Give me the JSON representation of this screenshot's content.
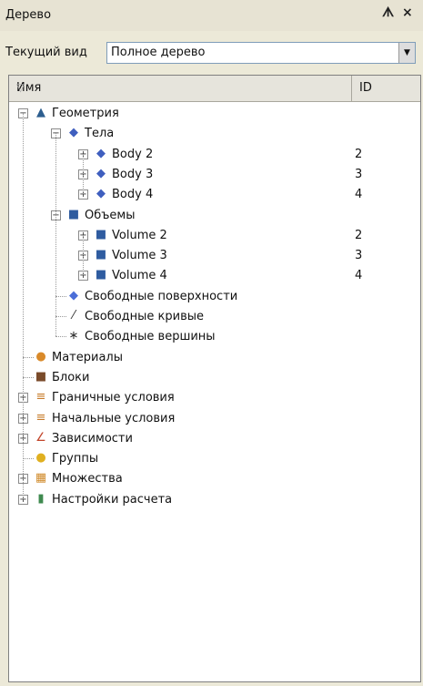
{
  "window": {
    "title": "Дерево",
    "pin_glyph": "ᗑ",
    "close_glyph": "×"
  },
  "view": {
    "label": "Текущий вид",
    "selected": "Полное дерево"
  },
  "columns": {
    "name": "Имя",
    "id": "ID"
  },
  "tree": [
    {
      "label": "Геометрия",
      "id": "",
      "level": 0,
      "icon": "geometry-icon",
      "glyph": "▲",
      "color": "#2d5e8f",
      "expander": "⊟"
    },
    {
      "label": "Тела",
      "id": "",
      "level": 1,
      "icon": "bodies-icon",
      "glyph": "◆",
      "color": "#3f5fbf",
      "expander": "⊟"
    },
    {
      "label": "Body 2",
      "id": "2",
      "level": 2,
      "icon": "body-icon",
      "glyph": "◆",
      "color": "#3f5fbf",
      "expander": "⊞"
    },
    {
      "label": "Body 3",
      "id": "3",
      "level": 2,
      "icon": "body-icon",
      "glyph": "◆",
      "color": "#3f5fbf",
      "expander": "⊞"
    },
    {
      "label": "Body 4",
      "id": "4",
      "level": 2,
      "icon": "body-icon",
      "glyph": "◆",
      "color": "#3f5fbf",
      "expander": "⊞"
    },
    {
      "label": "Объемы",
      "id": "",
      "level": 1,
      "icon": "volumes-icon",
      "glyph": "■",
      "color": "#2f5ca0",
      "expander": "⊟"
    },
    {
      "label": "Volume 2",
      "id": "2",
      "level": 2,
      "icon": "volume-icon",
      "glyph": "■",
      "color": "#2f5ca0",
      "expander": "⊞"
    },
    {
      "label": "Volume 3",
      "id": "3",
      "level": 2,
      "icon": "volume-icon",
      "glyph": "■",
      "color": "#2f5ca0",
      "expander": "⊞"
    },
    {
      "label": "Volume 4",
      "id": "4",
      "level": 2,
      "icon": "volume-icon",
      "glyph": "■",
      "color": "#2f5ca0",
      "expander": "⊞"
    },
    {
      "label": "Свободные поверхности",
      "id": "",
      "level": 1,
      "icon": "free-surfaces-icon",
      "glyph": "◆",
      "color": "#4b6ed8",
      "expander": ""
    },
    {
      "label": "Свободные кривые",
      "id": "",
      "level": 1,
      "icon": "free-curves-icon",
      "glyph": "⁄",
      "color": "#333333",
      "expander": ""
    },
    {
      "label": "Свободные вершины",
      "id": "",
      "level": 1,
      "icon": "free-vertices-icon",
      "glyph": "∗",
      "color": "#333333",
      "expander": ""
    },
    {
      "label": "Материалы",
      "id": "",
      "level": 0,
      "icon": "materials-icon",
      "glyph": "●",
      "color": "#d98a2a",
      "expander": ""
    },
    {
      "label": "Блоки",
      "id": "",
      "level": 0,
      "icon": "blocks-icon",
      "glyph": "■",
      "color": "#7a4b2a",
      "expander": ""
    },
    {
      "label": "Граничные условия",
      "id": "",
      "level": 0,
      "icon": "boundary-conditions-icon",
      "glyph": "≡",
      "color": "#c77b2a",
      "expander": "⊞"
    },
    {
      "label": "Начальные условия",
      "id": "",
      "level": 0,
      "icon": "initial-conditions-icon",
      "glyph": "≡",
      "color": "#c77b2a",
      "expander": "⊞"
    },
    {
      "label": "Зависимости",
      "id": "",
      "level": 0,
      "icon": "dependencies-icon",
      "glyph": "∠",
      "color": "#c2452a",
      "expander": "⊞"
    },
    {
      "label": "Группы",
      "id": "",
      "level": 0,
      "icon": "groups-icon",
      "glyph": "●",
      "color": "#e0b020",
      "expander": ""
    },
    {
      "label": "Множества",
      "id": "",
      "level": 0,
      "icon": "sets-icon",
      "glyph": "▦",
      "color": "#d08a2a",
      "expander": "⊞"
    },
    {
      "label": "Настройки расчета",
      "id": "",
      "level": 0,
      "icon": "calc-settings-icon",
      "glyph": "▮",
      "color": "#3f8a4f",
      "expander": "⊞"
    }
  ]
}
